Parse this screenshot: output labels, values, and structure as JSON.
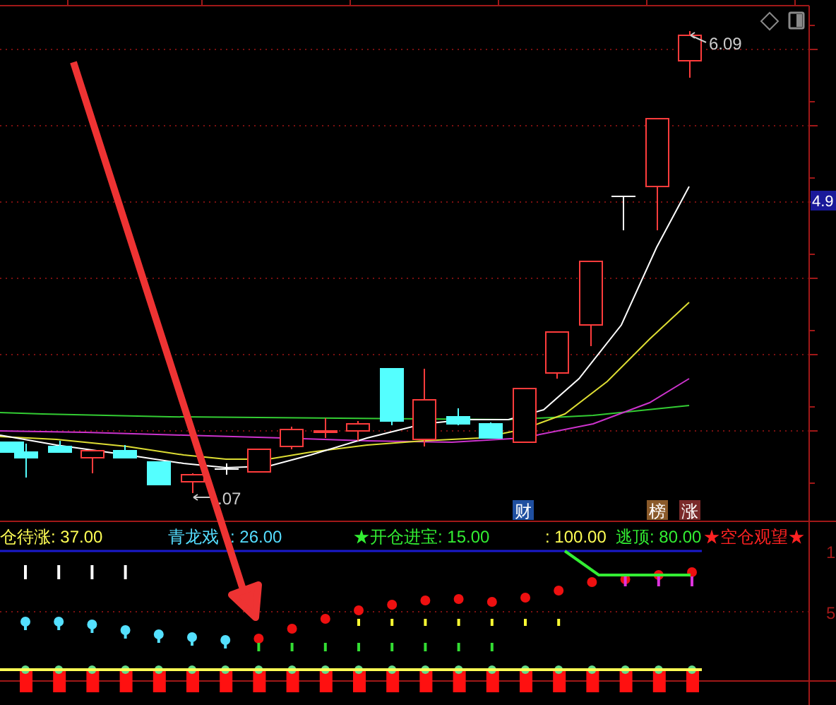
{
  "price_panel": {
    "high_label": "6.09",
    "low_label": ".07",
    "price_tag": "4.9",
    "badges": [
      {
        "text": "财",
        "color": "#1f4fa0"
      },
      {
        "text": "榜",
        "color": "#8a5a2a"
      },
      {
        "text": "涨",
        "color": "#7a2a2a"
      }
    ]
  },
  "indicator_panel": {
    "legend": [
      {
        "text": "仓待涨: 37.00",
        "color": "#ffff55"
      },
      {
        "text": "青龙戏",
        "color": "#55ddff"
      },
      {
        "text": ": 26.00",
        "color": "#55ddff"
      },
      {
        "text": "★开仓进宝: 15.00",
        "color": "#33ee33"
      },
      {
        "text": ": 100.00",
        "color": "#ffff55"
      },
      {
        "text": "逃顶: 80.00",
        "color": "#33ee33"
      },
      {
        "text": "★空仓观望★",
        "color": "#ff2222"
      }
    ],
    "axis_labels": [
      "1",
      "5"
    ]
  }
}
